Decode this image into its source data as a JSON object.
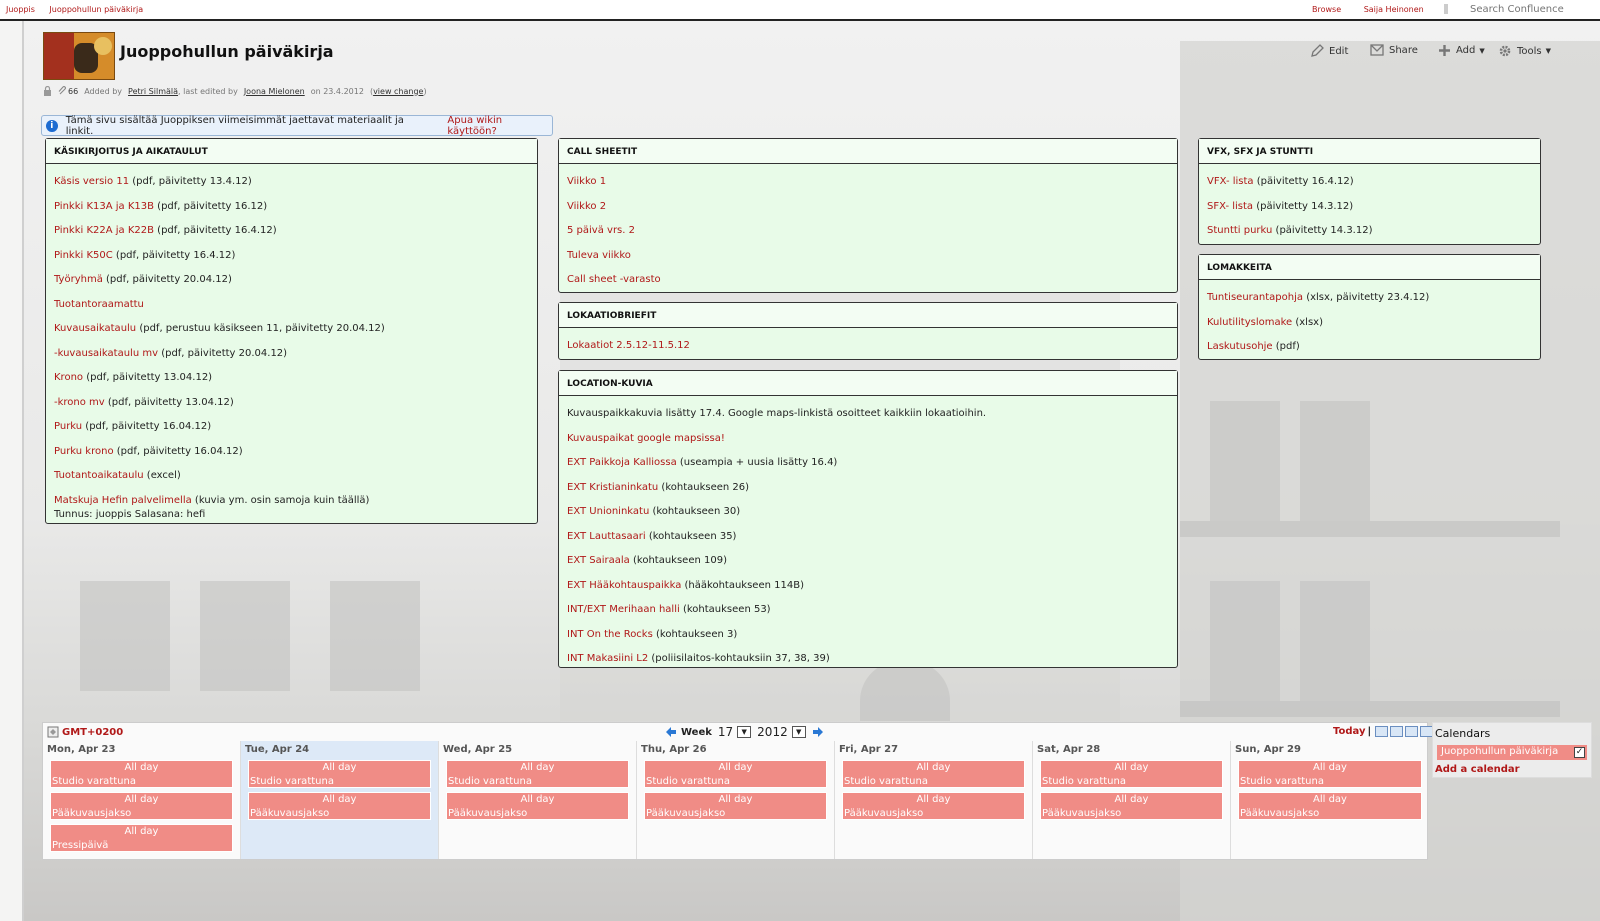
{
  "topnav": {
    "space_link": "Juoppis",
    "page_link": "Juoppohullun päiväkirja",
    "browse": "Browse",
    "user": "Saija Heinonen",
    "search_placeholder": "Search Confluence"
  },
  "header": {
    "title": "Juoppohullun päiväkirja",
    "edit": "Edit",
    "share": "Share",
    "add": "Add",
    "tools": "Tools"
  },
  "meta": {
    "attachments_count": "66",
    "added_by_label": "Added by",
    "author": "Petri Silmälä",
    "edited_by_label": ", last edited by",
    "editor": "Joona Mielonen",
    "on_date": "on 23.4.2012",
    "open_paren": "(",
    "view_change": "view change",
    "close_paren": ")"
  },
  "info": {
    "text": "Tämä sivu sisältää Juoppiksen viimeisimmät jaettavat materiaalit ja linkit.",
    "help_link": "Apua wikin käyttöön?"
  },
  "panels": {
    "kasikirjoitus": {
      "title": "KÄSIKIRJOITUS JA AIKATAULUT",
      "items": [
        {
          "link": "Käsis versio 11",
          "text": " (pdf, päivitetty 13.4.12)"
        },
        {
          "link": "Pinkki K13A ja K13B",
          "text": " (pdf, päivitetty 16.12)"
        },
        {
          "link": "Pinkki K22A ja K22B",
          "text": " (pdf, päivitetty 16.4.12)"
        },
        {
          "link": "Pinkki K50C",
          "text": " (pdf, päivitetty 16.4.12)"
        },
        {
          "link": "Työryhmä",
          "text": " (pdf, päivitetty 20.04.12)"
        },
        {
          "link": "Tuotantoraamattu",
          "text": ""
        },
        {
          "link": "Kuvausaikataulu",
          "text": " (pdf, perustuu käsikseen 11, päivitetty 20.04.12)"
        },
        {
          "link": "-kuvausaikataulu mv",
          "text": " (pdf, päivitetty 20.04.12)"
        },
        {
          "link": "Krono",
          "text": " (pdf, päivitetty 13.04.12)"
        },
        {
          "link": "-krono mv",
          "text": " (pdf, päivitetty 13.04.12)"
        },
        {
          "link": "Purku",
          "text": " (pdf, päivitetty 16.04.12)"
        },
        {
          "link": "Purku krono",
          "text": " (pdf, päivitetty 16.04.12)"
        },
        {
          "link": "Tuotantoaikataulu",
          "text": " (excel)"
        },
        {
          "link": "Matskuja Hefin palvelimella",
          "text": " (kuvia ym. osin samoja kuin täällä)",
          "extra": "Tunnus: juoppis Salasana: hefi"
        }
      ]
    },
    "callsheet": {
      "title": "CALL SHEETIT",
      "items": [
        {
          "link": "Viikko 1"
        },
        {
          "link": "Viikko 2"
        },
        {
          "link": "5 päivä vrs. 2"
        },
        {
          "link": "Tuleva viikko"
        },
        {
          "link": "Call sheet -varasto"
        }
      ]
    },
    "lokaatio": {
      "title": "LOKAATIOBRIEFIT",
      "items": [
        {
          "link": "Lokaatiot 2.5.12-11.5.12"
        }
      ]
    },
    "location": {
      "title": "LOCATION-KUVIA",
      "intro": "Kuvauspaikkakuvia lisätty 17.4. Google maps-linkistä osoitteet kaikkiin lokaatioihin.",
      "items": [
        {
          "link": "Kuvauspaikat google mapsissa!",
          "text": ""
        },
        {
          "link": "EXT Paikkoja Kalliossa",
          "text": " (useampia + uusia lisätty 16.4)"
        },
        {
          "link": "EXT Kristianinkatu",
          "text": " (kohtaukseen 26)"
        },
        {
          "link": "EXT Unioninkatu",
          "text": " (kohtaukseen 30)"
        },
        {
          "link": "EXT Lauttasaari",
          "text": " (kohtaukseen 35)"
        },
        {
          "link": "EXT Sairaala",
          "text": " (kohtaukseen 109)"
        },
        {
          "link": "EXT Hääkohtauspaikka",
          "text": " (hääkohtaukseen 114B)"
        },
        {
          "link": "INT/EXT Merihaan halli",
          "text": " (kohtaukseen 53)"
        },
        {
          "link": "INT On the Rocks",
          "text": " (kohtaukseen 3)"
        },
        {
          "link": "INT Makasiini L2",
          "text": " (poliisilaitos-kohtauksiin 37, 38, 39)"
        }
      ]
    },
    "vfx": {
      "title": "VFX, SFX JA STUNTTI",
      "items": [
        {
          "link": "VFX- lista",
          "text": " (päivitetty 16.4.12)"
        },
        {
          "link": "SFX- lista",
          "text": " (päivitetty 14.3.12)"
        },
        {
          "link": "Stuntti purku",
          "text": " (päivitetty 14.3.12)"
        }
      ]
    },
    "lomakkeita": {
      "title": "LOMAKKEITA",
      "items": [
        {
          "link": "Tuntiseurantapohja",
          "text": " (xlsx, päivitetty 23.4.12)"
        },
        {
          "link": "Kulutilityslomake",
          "text": " (xlsx)"
        },
        {
          "link": "Laskutusohje",
          "text": " (pdf)"
        }
      ]
    }
  },
  "calendar": {
    "timezone": "GMT+0200",
    "week_label": "Week",
    "week_number": "17",
    "year": "2012",
    "today": "Today",
    "view_separator": "|",
    "days": [
      {
        "name": "Mon, Apr 23",
        "events": [
          {
            "allday": "All day",
            "name": "Studio varattuna"
          },
          {
            "allday": "All day",
            "name": "Pääkuvausjakso"
          },
          {
            "allday": "All day",
            "name": "Pressipäivä"
          }
        ]
      },
      {
        "name": "Tue, Apr 24",
        "events": [
          {
            "allday": "All day",
            "name": "Studio varattuna"
          },
          {
            "allday": "All day",
            "name": "Pääkuvausjakso"
          }
        ]
      },
      {
        "name": "Wed, Apr 25",
        "events": [
          {
            "allday": "All day",
            "name": "Studio varattuna"
          },
          {
            "allday": "All day",
            "name": "Pääkuvausjakso"
          }
        ]
      },
      {
        "name": "Thu, Apr 26",
        "events": [
          {
            "allday": "All day",
            "name": "Studio varattuna"
          },
          {
            "allday": "All day",
            "name": "Pääkuvausjakso"
          }
        ]
      },
      {
        "name": "Fri, Apr 27",
        "events": [
          {
            "allday": "All day",
            "name": "Studio varattuna"
          },
          {
            "allday": "All day",
            "name": "Pääkuvausjakso"
          }
        ]
      },
      {
        "name": "Sat, Apr 28",
        "events": [
          {
            "allday": "All day",
            "name": "Studio varattuna"
          },
          {
            "allday": "All day",
            "name": "Pääkuvausjakso"
          }
        ]
      },
      {
        "name": "Sun, Apr 29",
        "events": [
          {
            "allday": "All day",
            "name": "Studio varattuna"
          },
          {
            "allday": "All day",
            "name": "Pääkuvausjakso"
          }
        ]
      }
    ],
    "sidebar": {
      "title": "Calendars",
      "item": "Juoppohullun päiväkirja",
      "checkmark": "✓",
      "add": "Add a calendar"
    }
  },
  "colors": {
    "link": "#b01818",
    "panel_bg": "#e8fbe8",
    "event_bg": "#f08c86",
    "highlight_day": "#dde9f7"
  }
}
